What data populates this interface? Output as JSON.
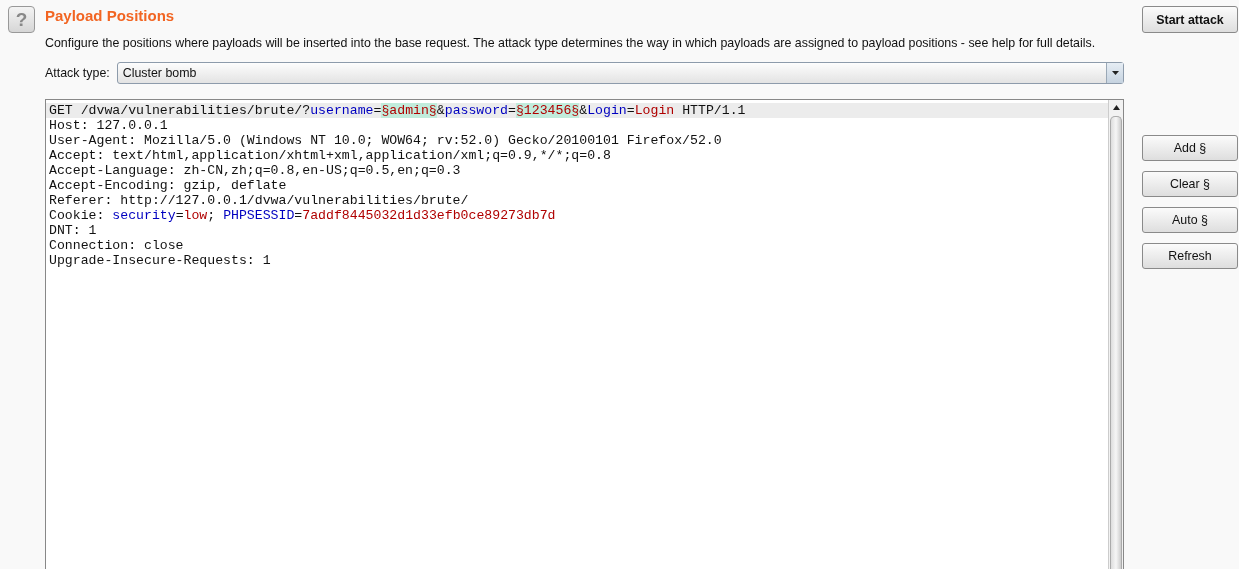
{
  "section": {
    "title": "Payload Positions",
    "help_icon": "?",
    "description": "Configure the positions where payloads will be inserted into the base request. The attack type determines the way in which payloads are assigned to payload positions - see help for full details."
  },
  "start_button": "Start attack",
  "attack_type": {
    "label": "Attack type:",
    "value": "Cluster bomb"
  },
  "request_lines": [
    {
      "current": true,
      "segments": [
        {
          "kind": "plain",
          "text": "GET /dvwa/vulnerabilities/brute/?"
        },
        {
          "kind": "name",
          "text": "username"
        },
        {
          "kind": "plain",
          "text": "="
        },
        {
          "kind": "payload",
          "text": "§admin§"
        },
        {
          "kind": "plain",
          "text": "&"
        },
        {
          "kind": "name",
          "text": "password"
        },
        {
          "kind": "plain",
          "text": "="
        },
        {
          "kind": "payload",
          "text": "§123456§"
        },
        {
          "kind": "plain",
          "text": "&"
        },
        {
          "kind": "name",
          "text": "Login"
        },
        {
          "kind": "plain",
          "text": "="
        },
        {
          "kind": "value",
          "text": "Login"
        },
        {
          "kind": "plain",
          "text": " HTTP/1.1"
        }
      ]
    },
    {
      "current": false,
      "segments": [
        {
          "kind": "plain",
          "text": "Host: 127.0.0.1"
        }
      ]
    },
    {
      "current": false,
      "segments": [
        {
          "kind": "plain",
          "text": "User-Agent: Mozilla/5.0 (Windows NT 10.0; WOW64; rv:52.0) Gecko/20100101 Firefox/52.0"
        }
      ]
    },
    {
      "current": false,
      "segments": [
        {
          "kind": "plain",
          "text": "Accept: text/html,application/xhtml+xml,application/xml;q=0.9,*/*;q=0.8"
        }
      ]
    },
    {
      "current": false,
      "segments": [
        {
          "kind": "plain",
          "text": "Accept-Language: zh-CN,zh;q=0.8,en-US;q=0.5,en;q=0.3"
        }
      ]
    },
    {
      "current": false,
      "segments": [
        {
          "kind": "plain",
          "text": "Accept-Encoding: gzip, deflate"
        }
      ]
    },
    {
      "current": false,
      "segments": [
        {
          "kind": "plain",
          "text": "Referer: http://127.0.0.1/dvwa/vulnerabilities/brute/"
        }
      ]
    },
    {
      "current": false,
      "segments": [
        {
          "kind": "plain",
          "text": "Cookie: "
        },
        {
          "kind": "name",
          "text": "security"
        },
        {
          "kind": "plain",
          "text": "="
        },
        {
          "kind": "value",
          "text": "low"
        },
        {
          "kind": "plain",
          "text": "; "
        },
        {
          "kind": "name",
          "text": "PHPSESSID"
        },
        {
          "kind": "plain",
          "text": "="
        },
        {
          "kind": "value",
          "text": "7addf8445032d1d33efb0ce89273db7d"
        }
      ]
    },
    {
      "current": false,
      "segments": [
        {
          "kind": "plain",
          "text": "DNT: 1"
        }
      ]
    },
    {
      "current": false,
      "segments": [
        {
          "kind": "plain",
          "text": "Connection: close"
        }
      ]
    },
    {
      "current": false,
      "segments": [
        {
          "kind": "plain",
          "text": "Upgrade-Insecure-Requests: 1"
        }
      ]
    }
  ],
  "side_buttons": [
    "Add §",
    "Clear §",
    "Auto §",
    "Refresh"
  ]
}
